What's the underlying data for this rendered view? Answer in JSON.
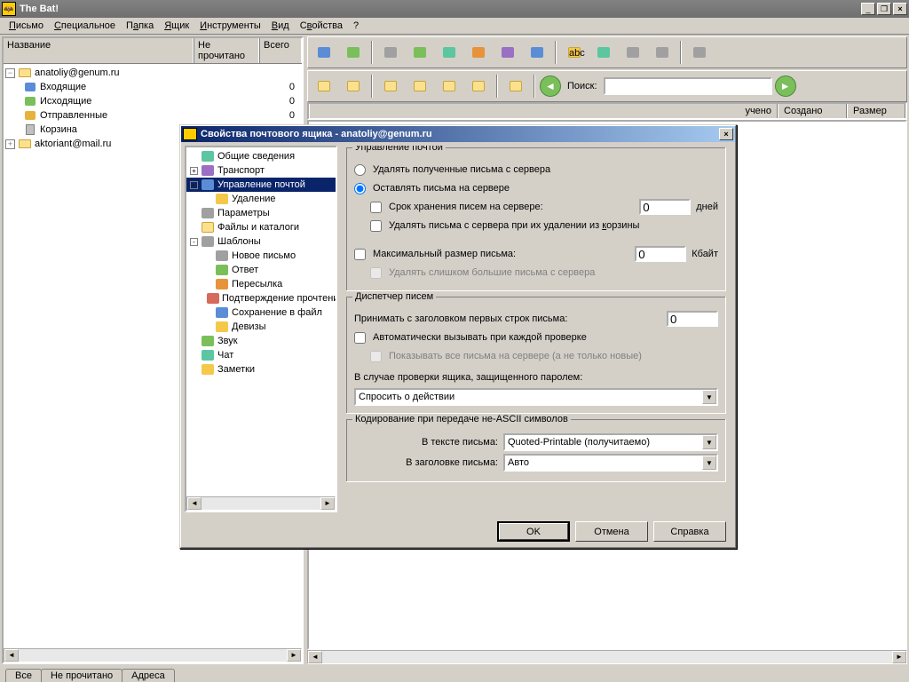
{
  "app": {
    "title": "The Bat!"
  },
  "menu": [
    "Письмо",
    "Специальное",
    "Папка",
    "Ящик",
    "Инструменты",
    "Вид",
    "Свойства",
    "?"
  ],
  "left_tree": {
    "headers": [
      "Название",
      "Не прочитано",
      "Всего"
    ],
    "accounts": [
      {
        "name": "anatoliy@genum.ru",
        "expanded": true,
        "folders": [
          {
            "name": "Входящие",
            "unread": "",
            "total": "0",
            "icon": "blue"
          },
          {
            "name": "Исходящие",
            "unread": "",
            "total": "0",
            "icon": "green"
          },
          {
            "name": "Отправленные",
            "unread": "",
            "total": "0",
            "icon": "orange"
          },
          {
            "name": "Корзина",
            "unread": "",
            "total": "",
            "icon": "trash"
          }
        ]
      },
      {
        "name": "aktoriant@mail.ru",
        "expanded": false
      }
    ]
  },
  "search": {
    "label": "Поиск:",
    "value": ""
  },
  "list_headers": [
    "учено",
    "Создано",
    "Размер"
  ],
  "footer_tabs": [
    "Все",
    "Не прочитано",
    "Адреса"
  ],
  "dialog": {
    "title": "Свойства почтового ящика - anatoliy@genum.ru",
    "tree": [
      {
        "label": "Общие сведения",
        "icon": "c-teal",
        "depth": 0
      },
      {
        "label": "Транспорт",
        "icon": "c-purple",
        "depth": 0,
        "toggle": "+"
      },
      {
        "label": "Управление почтой",
        "icon": "c-blue",
        "depth": 0,
        "toggle": "-",
        "selected": true
      },
      {
        "label": "Удаление",
        "icon": "c-yellow",
        "depth": 1
      },
      {
        "label": "Параметры",
        "icon": "c-gray",
        "depth": 0
      },
      {
        "label": "Файлы и каталоги",
        "icon": "c-folder",
        "depth": 0
      },
      {
        "label": "Шаблоны",
        "icon": "c-gray",
        "depth": 0,
        "toggle": "-"
      },
      {
        "label": "Новое письмо",
        "icon": "c-gray",
        "depth": 1
      },
      {
        "label": "Ответ",
        "icon": "c-green",
        "depth": 1
      },
      {
        "label": "Пересылка",
        "icon": "c-orange",
        "depth": 1
      },
      {
        "label": "Подтверждение прочтения",
        "icon": "c-red",
        "depth": 1
      },
      {
        "label": "Сохранение в файл",
        "icon": "c-blue",
        "depth": 1
      },
      {
        "label": "Девизы",
        "icon": "c-yellow",
        "depth": 1
      },
      {
        "label": "Звук",
        "icon": "c-green",
        "depth": 0
      },
      {
        "label": "Чат",
        "icon": "c-teal",
        "depth": 0
      },
      {
        "label": "Заметки",
        "icon": "c-yellow",
        "depth": 0
      }
    ],
    "groups": {
      "mail_mgmt": {
        "legend": "Управление почтой",
        "radio_delete": "Удалять полученные письма с сервера",
        "radio_keep": "Оставлять письма на сервере",
        "chk_keep_days": "Срок хранения писем на сервере:",
        "days_value": "0",
        "days_unit": "дней",
        "chk_del_on_trash": "Удалять письма с сервера при их удалении из корзины",
        "chk_max_size": "Максимальный размер письма:",
        "size_value": "0",
        "size_unit": "Кбайт",
        "chk_del_large": "Удалять слишком большие письма с сервера"
      },
      "dispatcher": {
        "legend": "Диспетчер писем",
        "header_lines": "Принимать с заголовком первых строк письма:",
        "lines_value": "0",
        "chk_auto": "Автоматически вызывать при каждой проверке",
        "chk_show_all": "Показывать все письма на сервере (а не только новые)",
        "pwd_label": "В случае проверки ящика, защищенного паролем:",
        "pwd_combo": "Спросить о действии"
      },
      "encoding": {
        "legend": "Кодирование при передаче не-ASCII символов",
        "body_label": "В тексте письма:",
        "body_combo": "Quoted-Printable (получитаемо)",
        "header_label": "В заголовке письма:",
        "header_combo": "Авто"
      }
    },
    "buttons": {
      "ok": "OK",
      "cancel": "Отмена",
      "help": "Справка"
    }
  }
}
